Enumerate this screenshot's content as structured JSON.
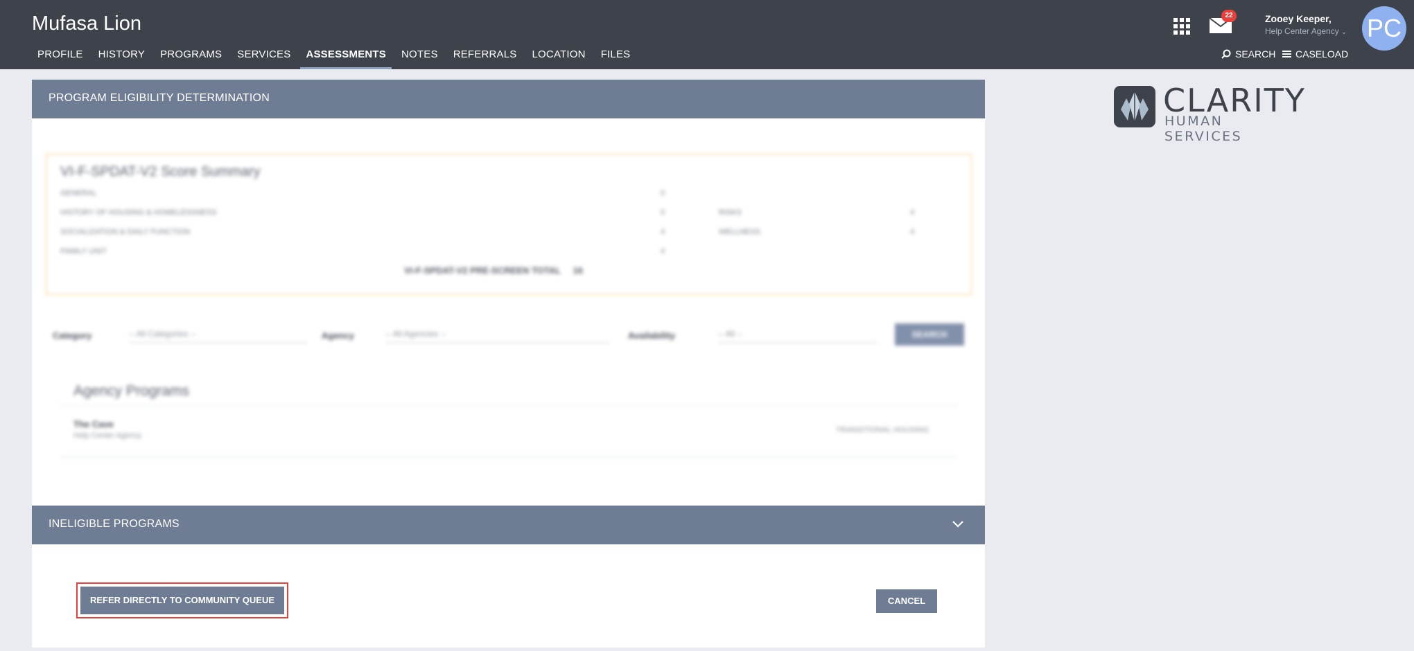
{
  "header": {
    "client_name": "Mufasa Lion",
    "nav": [
      "PROFILE",
      "HISTORY",
      "PROGRAMS",
      "SERVICES",
      "ASSESSMENTS",
      "NOTES",
      "REFERRALS",
      "LOCATION",
      "FILES"
    ],
    "active_tab": "ASSESSMENTS",
    "notification_count": "22",
    "user_name": "Zooey Keeper,",
    "user_agency": "Help Center Agency",
    "avatar_initials": "PC",
    "search_label": "SEARCH",
    "caseload_label": "CASELOAD"
  },
  "eligibility": {
    "header": "PROGRAM ELIGIBILITY DETERMINATION",
    "score_summary": {
      "title": "VI-F-SPDAT-V2 Score Summary",
      "rows": [
        {
          "label": "GENERAL",
          "value": "0"
        },
        {
          "label": "HISTORY OF HOUSING & HOMELESSNESS",
          "value": "0"
        },
        {
          "label": "SOCIALIZATION & DAILY FUNCTION",
          "value": "4"
        },
        {
          "label": "FAMILY UNIT",
          "value": "4"
        }
      ],
      "right_rows": [
        {
          "label": "RISKS",
          "value": "4"
        },
        {
          "label": "WELLNESS",
          "value": "4"
        }
      ],
      "total_label": "VI-F-SPDAT-V2 PRE-SCREEN TOTAL",
      "total_value": "16"
    },
    "filters": {
      "category_label": "Category",
      "category_value": "-- All Categories --",
      "agency_label": "Agency",
      "agency_value": "-- All Agencies --",
      "availability_label": "Availability",
      "availability_value": "-- All --",
      "search_button": "SEARCH"
    },
    "agency_programs": {
      "title": "Agency Programs",
      "program_name": "The Cave",
      "program_agency": "Help Center Agency",
      "program_type": "TRANSITIONAL HOUSING"
    }
  },
  "ineligible": {
    "header": "INELIGIBLE PROGRAMS"
  },
  "actions": {
    "refer_label": "REFER DIRECTLY TO COMMUNITY QUEUE",
    "cancel_label": "CANCEL"
  },
  "logo": {
    "word": "CLARITY",
    "sub": "HUMAN SERVICES"
  }
}
